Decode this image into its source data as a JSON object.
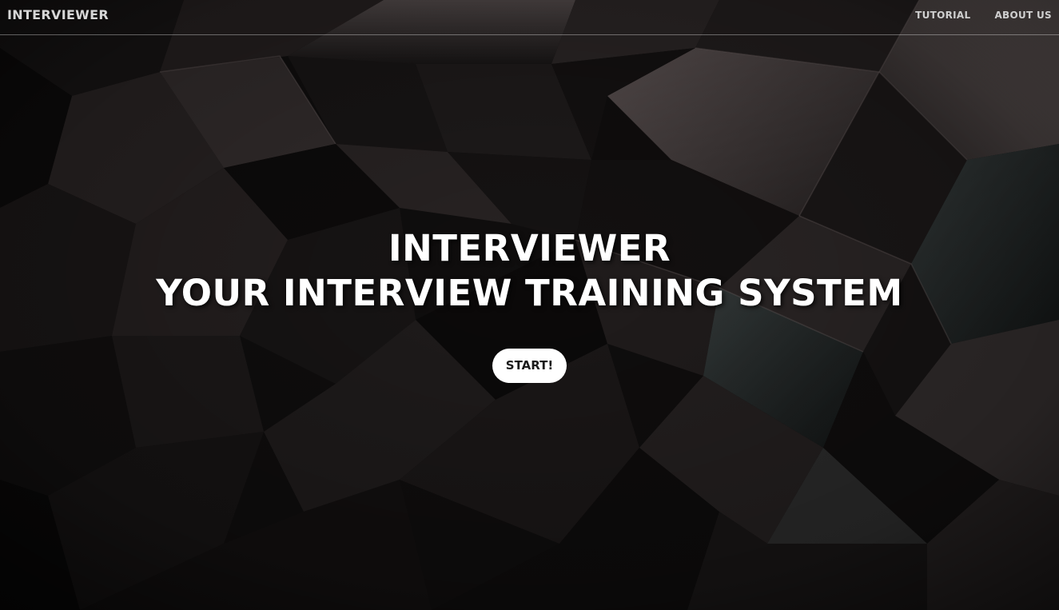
{
  "navbar": {
    "brand": "INTERVIEWER",
    "links": [
      {
        "label": "TUTORIAL"
      },
      {
        "label": "ABOUT US"
      }
    ]
  },
  "hero": {
    "title_line1": "INTERVIEWER",
    "title_line2": "YOUR INTERVIEW TRAINING SYSTEM",
    "start_label": "START!"
  },
  "theme": {
    "background": "#0d0c0c",
    "text": "#ffffff",
    "button_bg": "#ffffff",
    "button_text": "#1b1b1b"
  }
}
